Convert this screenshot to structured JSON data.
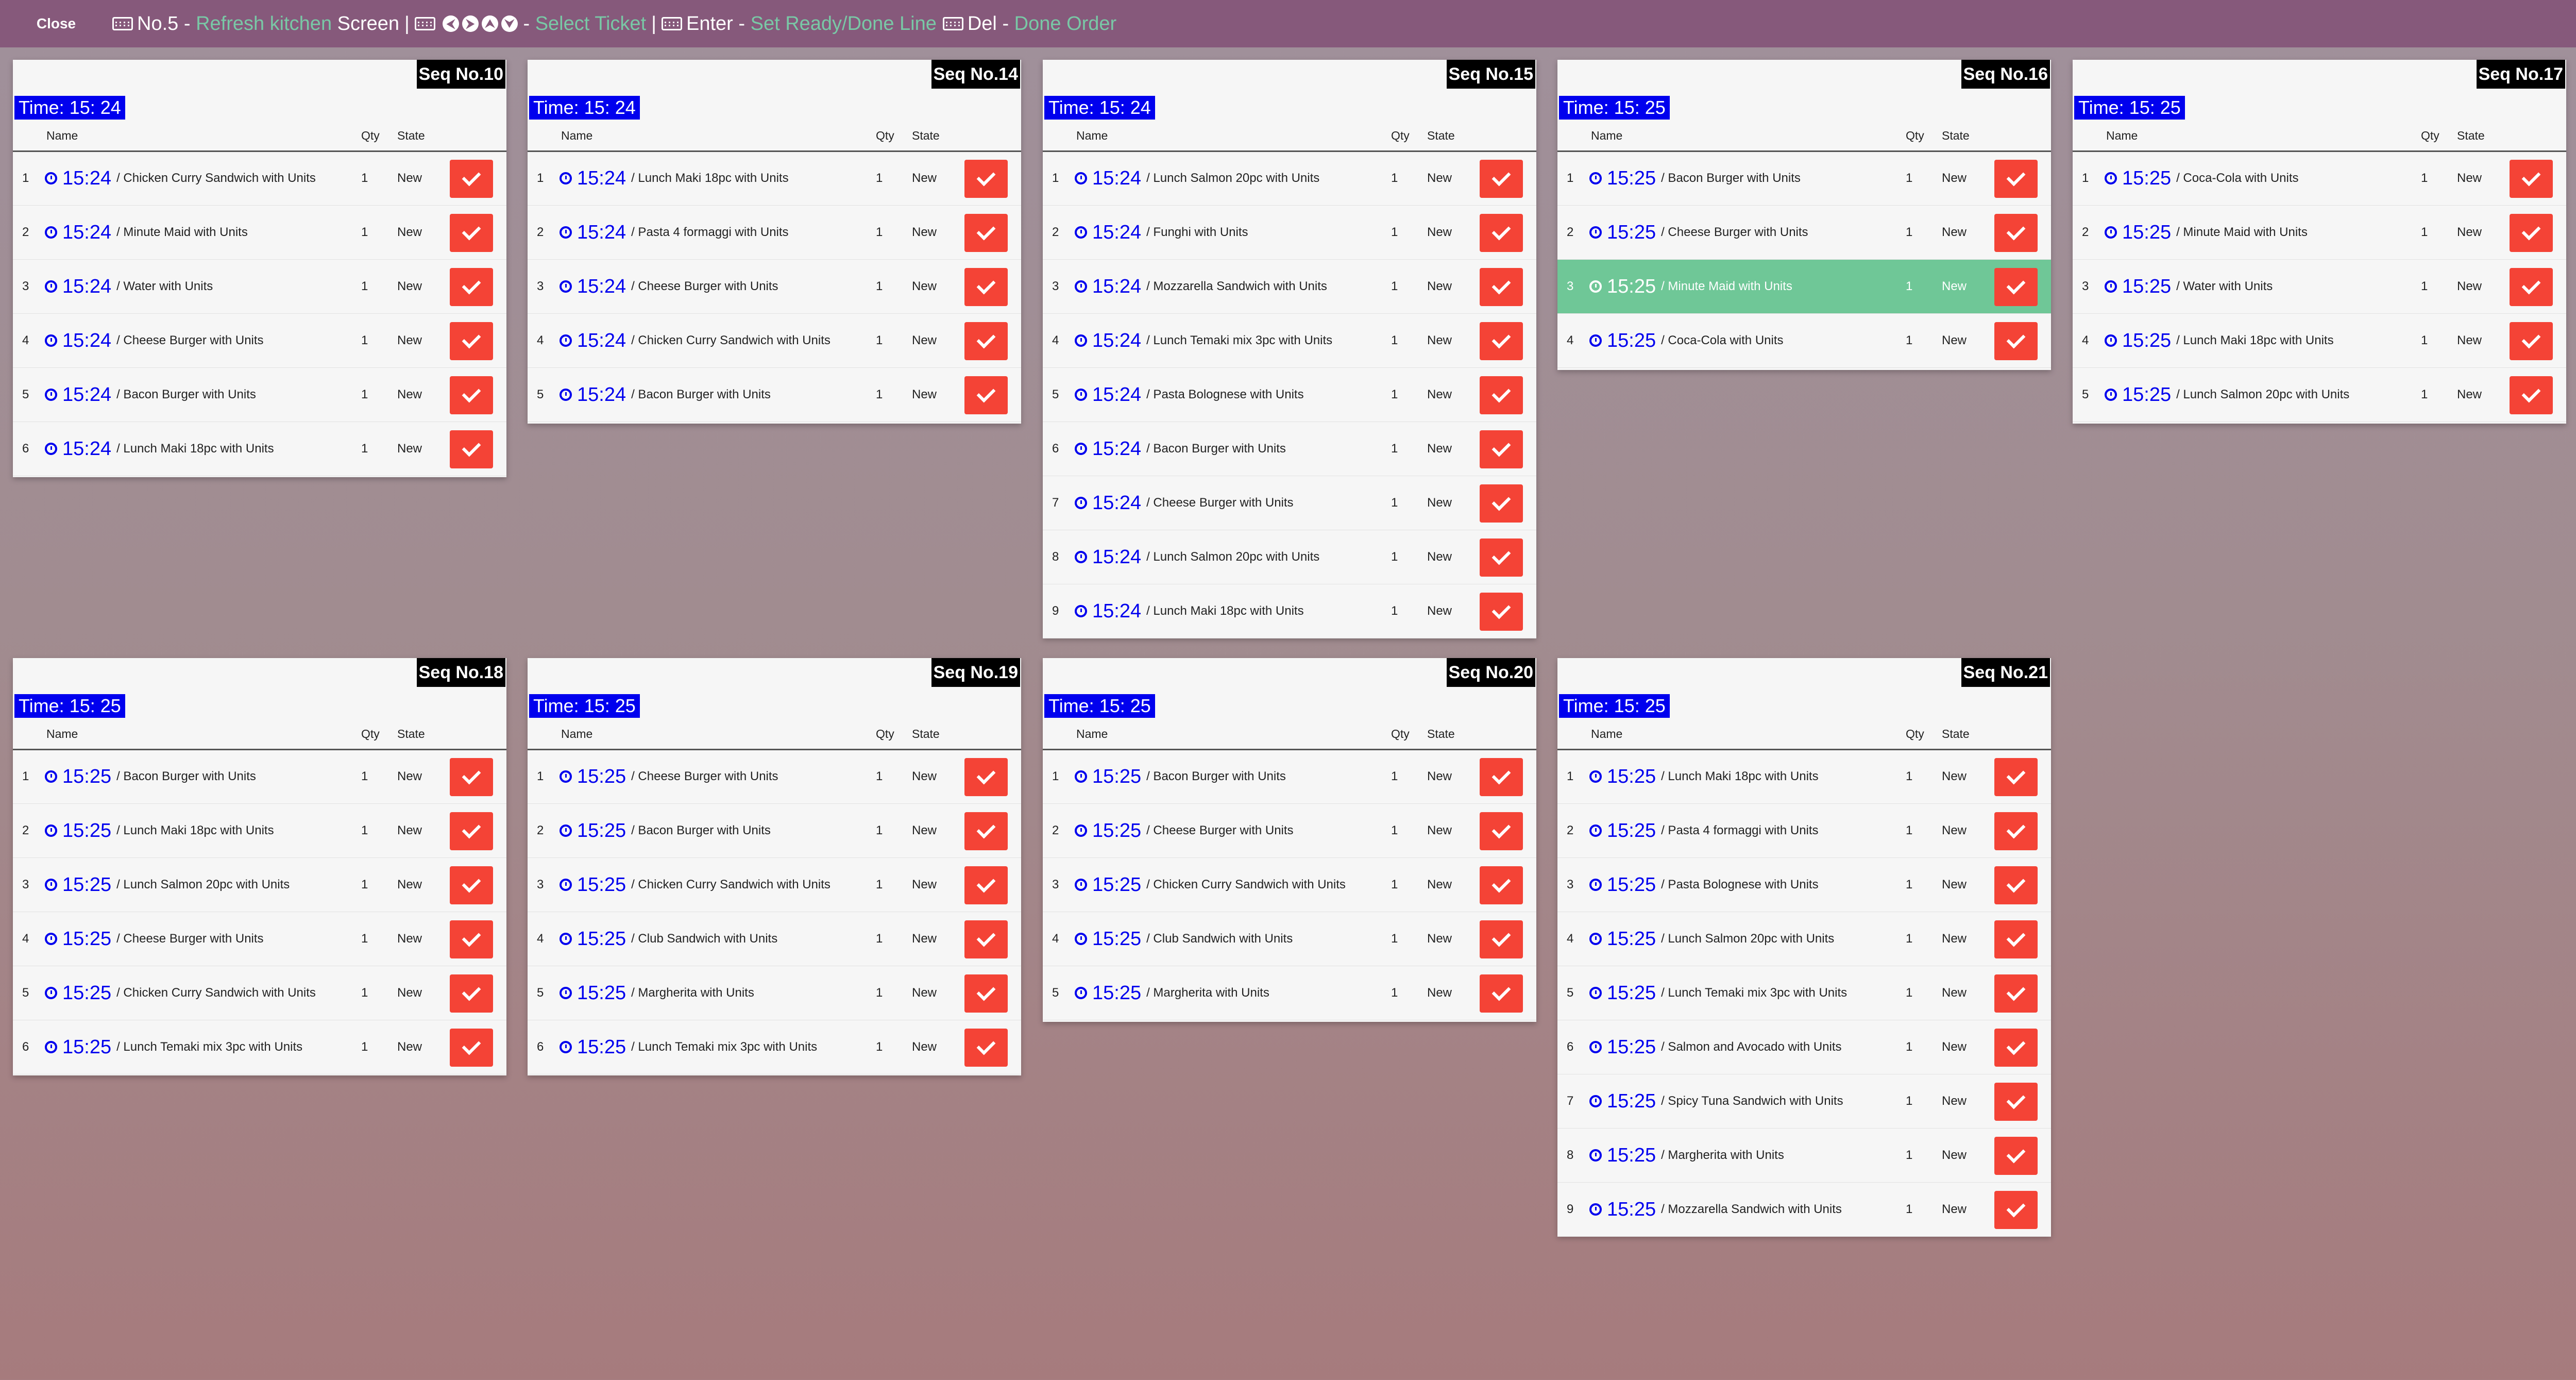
{
  "topbar": {
    "close_label": "Close",
    "k1_key": "No.5",
    "k1_dash": " - ",
    "k1_action": "Refresh kitchen",
    "k1_tail": " Screen",
    "sep": "|",
    "k2_dash": " - ",
    "k2_action": "Select Ticket",
    "k3_key": "Enter",
    "k3_dash": " - ",
    "k3_action": "Set Ready/Done Line",
    "k4_key": "Del",
    "k4_dash": " - ",
    "k4_action": "Done Order",
    "arrows": [
      "⮜",
      "⮞",
      "⮝",
      "⮟"
    ],
    "accent_color": "#79c8a6",
    "bar_color": "#86597b"
  },
  "headers": {
    "name": "Name",
    "qty": "Qty",
    "state": "State"
  },
  "tickets": [
    {
      "seq": "Seq No.10",
      "time": "Time: 15: 24",
      "items": [
        {
          "no": "1",
          "time": "15:24",
          "name": "/ Chicken Curry Sandwich with Units",
          "qty": "1",
          "state": "New"
        },
        {
          "no": "2",
          "time": "15:24",
          "name": "/ Minute Maid with Units",
          "qty": "1",
          "state": "New"
        },
        {
          "no": "3",
          "time": "15:24",
          "name": "/ Water with Units",
          "qty": "1",
          "state": "New"
        },
        {
          "no": "4",
          "time": "15:24",
          "name": "/ Cheese Burger with Units",
          "qty": "1",
          "state": "New"
        },
        {
          "no": "5",
          "time": "15:24",
          "name": "/ Bacon Burger with Units",
          "qty": "1",
          "state": "New"
        },
        {
          "no": "6",
          "time": "15:24",
          "name": "/ Lunch Maki 18pc with Units",
          "qty": "1",
          "state": "New"
        }
      ]
    },
    {
      "seq": "Seq No.14",
      "time": "Time: 15: 24",
      "items": [
        {
          "no": "1",
          "time": "15:24",
          "name": "/ Lunch Maki 18pc with Units",
          "qty": "1",
          "state": "New"
        },
        {
          "no": "2",
          "time": "15:24",
          "name": "/ Pasta 4 formaggi with Units",
          "qty": "1",
          "state": "New"
        },
        {
          "no": "3",
          "time": "15:24",
          "name": "/ Cheese Burger with Units",
          "qty": "1",
          "state": "New"
        },
        {
          "no": "4",
          "time": "15:24",
          "name": "/ Chicken Curry Sandwich with Units",
          "qty": "1",
          "state": "New"
        },
        {
          "no": "5",
          "time": "15:24",
          "name": "/ Bacon Burger with Units",
          "qty": "1",
          "state": "New"
        }
      ]
    },
    {
      "seq": "Seq No.15",
      "time": "Time: 15: 24",
      "items": [
        {
          "no": "1",
          "time": "15:24",
          "name": "/ Lunch Salmon 20pc with Units",
          "qty": "1",
          "state": "New"
        },
        {
          "no": "2",
          "time": "15:24",
          "name": "/ Funghi with Units",
          "qty": "1",
          "state": "New"
        },
        {
          "no": "3",
          "time": "15:24",
          "name": "/ Mozzarella Sandwich with Units",
          "qty": "1",
          "state": "New"
        },
        {
          "no": "4",
          "time": "15:24",
          "name": "/ Lunch Temaki mix 3pc with Units",
          "qty": "1",
          "state": "New"
        },
        {
          "no": "5",
          "time": "15:24",
          "name": "/ Pasta Bolognese with Units",
          "qty": "1",
          "state": "New"
        },
        {
          "no": "6",
          "time": "15:24",
          "name": "/ Bacon Burger with Units",
          "qty": "1",
          "state": "New"
        },
        {
          "no": "7",
          "time": "15:24",
          "name": "/ Cheese Burger with Units",
          "qty": "1",
          "state": "New"
        },
        {
          "no": "8",
          "time": "15:24",
          "name": "/ Lunch Salmon 20pc with Units",
          "qty": "1",
          "state": "New"
        },
        {
          "no": "9",
          "time": "15:24",
          "name": "/ Lunch Maki 18pc with Units",
          "qty": "1",
          "state": "New"
        }
      ]
    },
    {
      "seq": "Seq No.16",
      "time": "Time: 15: 25",
      "items": [
        {
          "no": "1",
          "time": "15:25",
          "name": "/ Bacon Burger with Units",
          "qty": "1",
          "state": "New"
        },
        {
          "no": "2",
          "time": "15:25",
          "name": "/ Cheese Burger with Units",
          "qty": "1",
          "state": "New"
        },
        {
          "no": "3",
          "time": "15:25",
          "name": "/ Minute Maid with Units",
          "qty": "1",
          "state": "New",
          "selected": true
        },
        {
          "no": "4",
          "time": "15:25",
          "name": "/ Coca-Cola with Units",
          "qty": "1",
          "state": "New"
        }
      ]
    },
    {
      "seq": "Seq No.17",
      "time": "Time: 15: 25",
      "items": [
        {
          "no": "1",
          "time": "15:25",
          "name": "/ Coca-Cola with Units",
          "qty": "1",
          "state": "New"
        },
        {
          "no": "2",
          "time": "15:25",
          "name": "/ Minute Maid with Units",
          "qty": "1",
          "state": "New"
        },
        {
          "no": "3",
          "time": "15:25",
          "name": "/ Water with Units",
          "qty": "1",
          "state": "New"
        },
        {
          "no": "4",
          "time": "15:25",
          "name": "/ Lunch Maki 18pc with Units",
          "qty": "1",
          "state": "New"
        },
        {
          "no": "5",
          "time": "15:25",
          "name": "/ Lunch Salmon 20pc with Units",
          "qty": "1",
          "state": "New"
        }
      ]
    },
    {
      "seq": "Seq No.18",
      "time": "Time: 15: 25",
      "items": [
        {
          "no": "1",
          "time": "15:25",
          "name": "/ Bacon Burger with Units",
          "qty": "1",
          "state": "New"
        },
        {
          "no": "2",
          "time": "15:25",
          "name": "/ Lunch Maki 18pc with Units",
          "qty": "1",
          "state": "New"
        },
        {
          "no": "3",
          "time": "15:25",
          "name": "/ Lunch Salmon 20pc with Units",
          "qty": "1",
          "state": "New"
        },
        {
          "no": "4",
          "time": "15:25",
          "name": "/ Cheese Burger with Units",
          "qty": "1",
          "state": "New"
        },
        {
          "no": "5",
          "time": "15:25",
          "name": "/ Chicken Curry Sandwich with Units",
          "qty": "1",
          "state": "New"
        },
        {
          "no": "6",
          "time": "15:25",
          "name": "/ Lunch Temaki mix 3pc with Units",
          "qty": "1",
          "state": "New"
        }
      ]
    },
    {
      "seq": "Seq No.19",
      "time": "Time: 15: 25",
      "items": [
        {
          "no": "1",
          "time": "15:25",
          "name": "/ Cheese Burger with Units",
          "qty": "1",
          "state": "New"
        },
        {
          "no": "2",
          "time": "15:25",
          "name": "/ Bacon Burger with Units",
          "qty": "1",
          "state": "New"
        },
        {
          "no": "3",
          "time": "15:25",
          "name": "/ Chicken Curry Sandwich with Units",
          "qty": "1",
          "state": "New"
        },
        {
          "no": "4",
          "time": "15:25",
          "name": "/ Club Sandwich with Units",
          "qty": "1",
          "state": "New"
        },
        {
          "no": "5",
          "time": "15:25",
          "name": "/ Margherita with Units",
          "qty": "1",
          "state": "New"
        },
        {
          "no": "6",
          "time": "15:25",
          "name": "/ Lunch Temaki mix 3pc with Units",
          "qty": "1",
          "state": "New"
        }
      ]
    },
    {
      "seq": "Seq No.20",
      "time": "Time: 15: 25",
      "items": [
        {
          "no": "1",
          "time": "15:25",
          "name": "/ Bacon Burger with Units",
          "qty": "1",
          "state": "New"
        },
        {
          "no": "2",
          "time": "15:25",
          "name": "/ Cheese Burger with Units",
          "qty": "1",
          "state": "New"
        },
        {
          "no": "3",
          "time": "15:25",
          "name": "/ Chicken Curry Sandwich with Units",
          "qty": "1",
          "state": "New"
        },
        {
          "no": "4",
          "time": "15:25",
          "name": "/ Club Sandwich with Units",
          "qty": "1",
          "state": "New"
        },
        {
          "no": "5",
          "time": "15:25",
          "name": "/ Margherita with Units",
          "qty": "1",
          "state": "New"
        }
      ]
    },
    {
      "seq": "Seq No.21",
      "time": "Time: 15: 25",
      "items": [
        {
          "no": "1",
          "time": "15:25",
          "name": "/ Lunch Maki 18pc with Units",
          "qty": "1",
          "state": "New"
        },
        {
          "no": "2",
          "time": "15:25",
          "name": "/ Pasta 4 formaggi with Units",
          "qty": "1",
          "state": "New"
        },
        {
          "no": "3",
          "time": "15:25",
          "name": "/ Pasta Bolognese with Units",
          "qty": "1",
          "state": "New"
        },
        {
          "no": "4",
          "time": "15:25",
          "name": "/ Lunch Salmon 20pc with Units",
          "qty": "1",
          "state": "New"
        },
        {
          "no": "5",
          "time": "15:25",
          "name": "/ Lunch Temaki mix 3pc with Units",
          "qty": "1",
          "state": "New"
        },
        {
          "no": "6",
          "time": "15:25",
          "name": "/ Salmon and Avocado with Units",
          "qty": "1",
          "state": "New"
        },
        {
          "no": "7",
          "time": "15:25",
          "name": "/ Spicy Tuna Sandwich with Units",
          "qty": "1",
          "state": "New"
        },
        {
          "no": "8",
          "time": "15:25",
          "name": "/ Margherita with Units",
          "qty": "1",
          "state": "New"
        },
        {
          "no": "9",
          "time": "15:25",
          "name": "/ Mozzarella Sandwich with Units",
          "qty": "1",
          "state": "New"
        }
      ]
    }
  ]
}
